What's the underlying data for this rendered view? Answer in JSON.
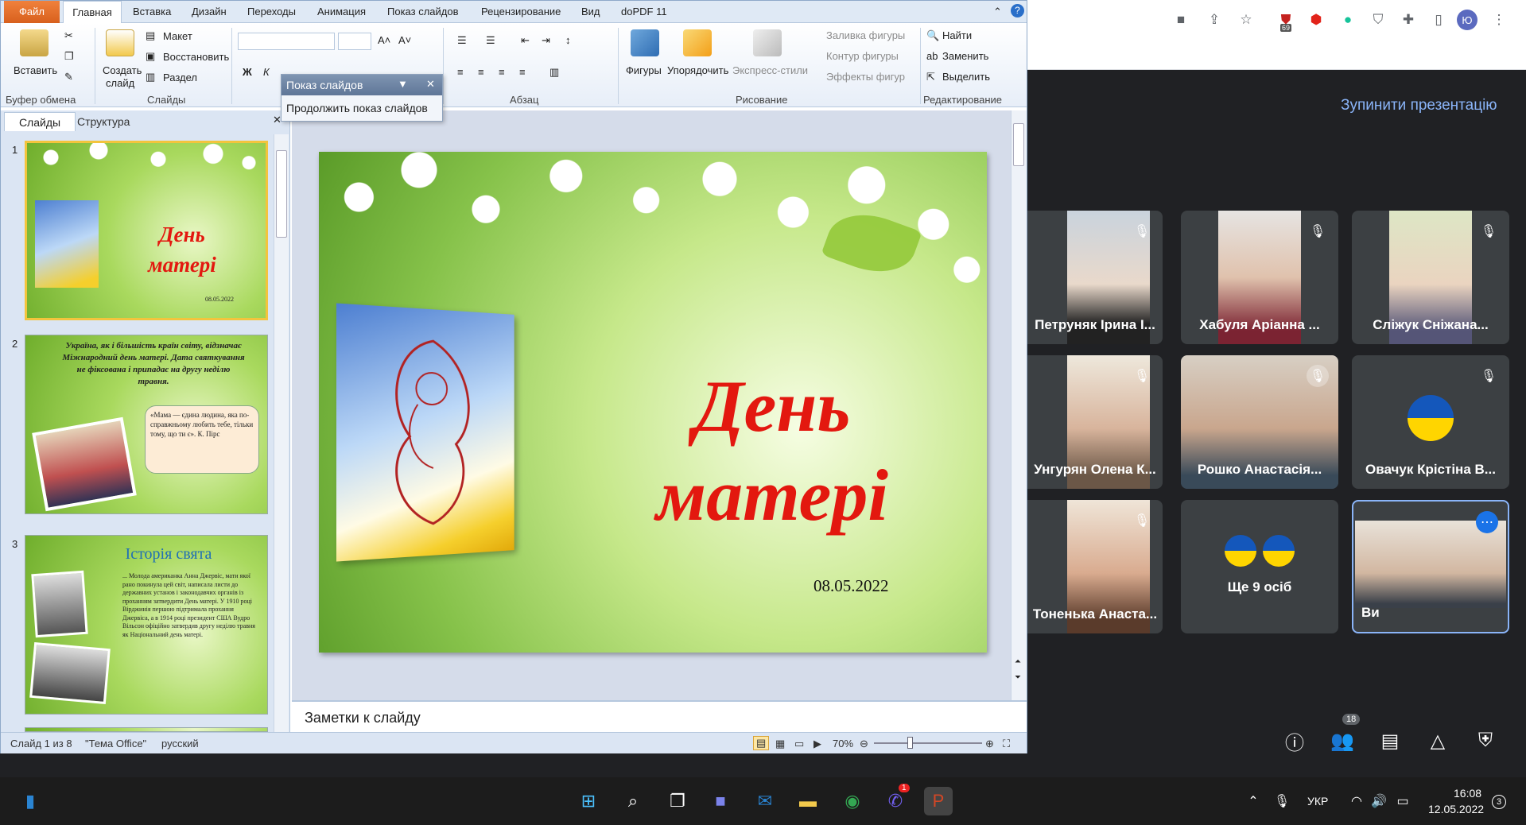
{
  "ppt": {
    "tabs": [
      "Файл",
      "Главная",
      "Вставка",
      "Дизайн",
      "Переходы",
      "Анимация",
      "Показ слайдов",
      "Рецензирование",
      "Вид",
      "doPDF 11"
    ],
    "ribbon": {
      "paste": "Вставить",
      "clipboard_group": "Буфер обмена",
      "new_slide_l1": "Создать",
      "new_slide_l2": "слайд",
      "layout": "Макет",
      "reset": "Восстановить",
      "section": "Раздел",
      "slides_group": "Слайды",
      "paragraph_group": "Абзац",
      "shapes": "Фигуры",
      "arrange": "Упорядочить",
      "quick_styles": "Экспресс-стили",
      "shape_fill": "Заливка фигуры",
      "shape_outline": "Контур фигуры",
      "shape_effects": "Эффекты фигур",
      "drawing_group": "Рисование",
      "find": "Найти",
      "replace": "Заменить",
      "select": "Выделить",
      "editing_group": "Редактирование"
    },
    "popup": {
      "title": "Показ слайдов",
      "item": "Продолжить показ слайдов"
    },
    "pane": {
      "tab_slides": "Слайды",
      "tab_outline": "Структура",
      "thumbs": [
        {
          "num": "1",
          "title": "День матері",
          "date": "08.05.2022"
        },
        {
          "num": "2",
          "text": "Україна, як і більшість країн світу, відзначає Міжнародний день матері. Дата святкування не фіксована і припадає на другу неділю травня.",
          "quote": "«Мама — єдина людина, яка по-справжньому любить тебе, тільки тому, що ти є». К. Пірс"
        },
        {
          "num": "3",
          "title": "Історія свята",
          "text": "... Молода американка Анна Джервіс, мати якої рано покинула цей світ, написала листи до державних установ і законодавчих органів із проханням затвердити День матері. У 1910 році Вірджинія першою підтримала прохання Джервіса, а в 1914 році президент США Вудро Вільсон офіційно затвердив другу неділю травня як Національний день матері."
        }
      ]
    },
    "slide": {
      "title_l1": "День",
      "title_l2": "матері",
      "date": "08.05.2022"
    },
    "notes_placeholder": "Заметки к слайду",
    "status": {
      "slide_count": "Слайд 1 из 8",
      "theme": "\"Тема Office\"",
      "language": "русский",
      "zoom": "70%"
    }
  },
  "meet": {
    "stop_presenting": "Зупинити презентацію",
    "participants": [
      {
        "name": "Петруняк Ірина І..."
      },
      {
        "name": "Хабуля Аріанна ..."
      },
      {
        "name": "Сліжук Сніжана..."
      },
      {
        "name": "Унгурян Олена К..."
      },
      {
        "name": "Рошко Анастасія..."
      },
      {
        "name": "Овачук Крістіна В..."
      },
      {
        "name": "Тоненька Анаста..."
      },
      {
        "name": "Ще 9 осіб"
      },
      {
        "name": "Ви"
      }
    ],
    "people_count": "18",
    "chrome_badge": "69",
    "profile_initial": "Ю"
  },
  "taskbar": {
    "lang": "УКР",
    "time": "16:08",
    "date": "12.05.2022",
    "notif_count": "3",
    "viber_badge": "1"
  },
  "colors": {
    "title_red": "#e3180f",
    "meet_accent": "#8ab4f8",
    "ribbon_bg": "#dfe9f5"
  }
}
